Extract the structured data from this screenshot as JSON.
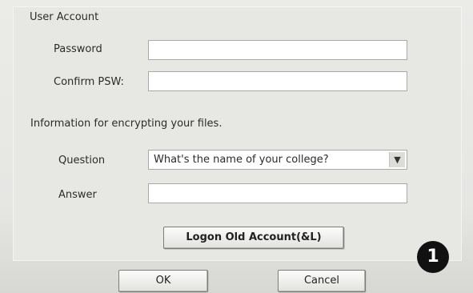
{
  "dialog": {
    "section_title": "User Account",
    "password_label": "Password",
    "password_value": "",
    "confirm_label": "Confirm PSW:",
    "confirm_value": "",
    "info_text": "Information for encrypting your files.",
    "question_label": "Question",
    "question_selected": "What's the name of your college?",
    "dropdown_icon": "chevron-down-icon",
    "answer_label": "Answer",
    "answer_value": "",
    "logon_label": "Logon Old Account(&L)",
    "ok_label": "OK",
    "cancel_label": "Cancel",
    "annotation_number": "1"
  }
}
